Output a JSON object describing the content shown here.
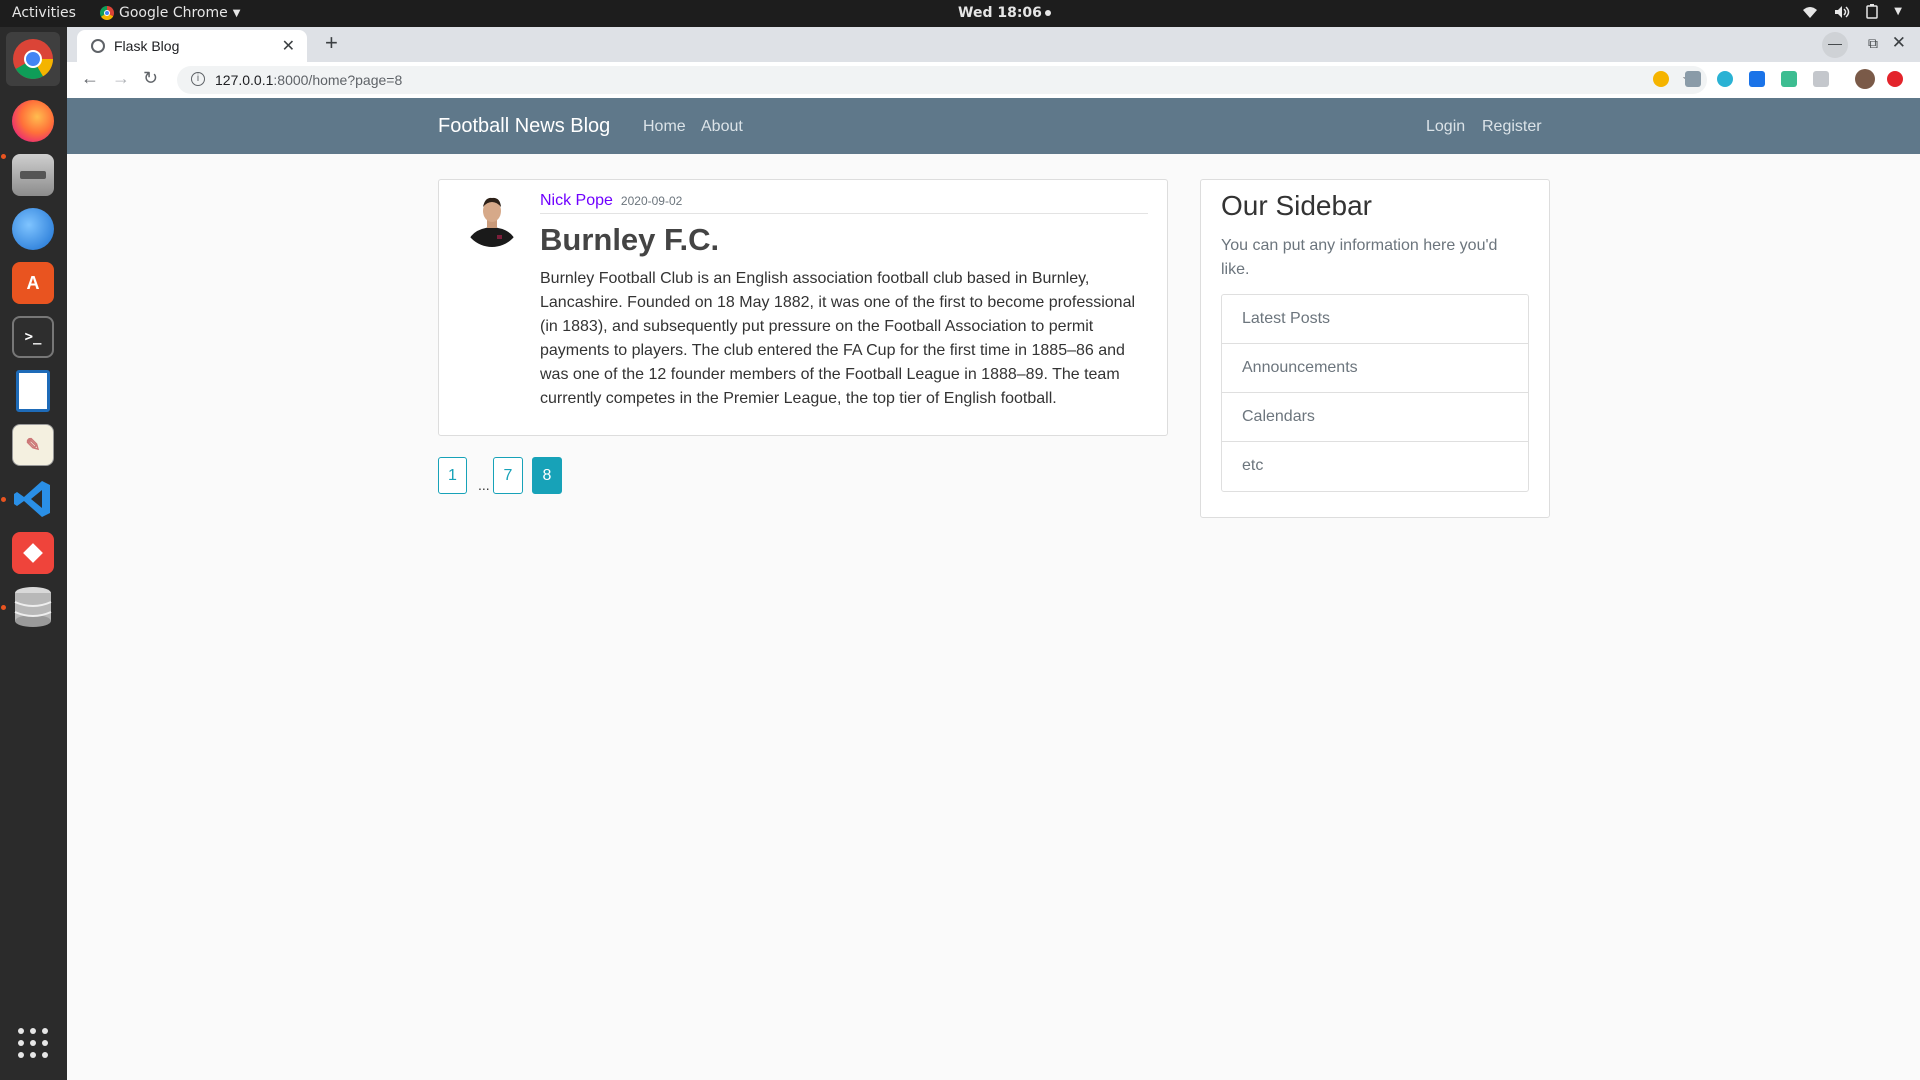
{
  "system": {
    "activities_label": "Activities",
    "app_name": "Google Chrome",
    "clock": "Wed 18:06"
  },
  "browser": {
    "tab_title": "Flask Blog",
    "url_host": "127.0.0.1",
    "url_path": ":8000/home?page=8"
  },
  "site": {
    "brand": "Football News Blog",
    "nav_left": [
      "Home",
      "About"
    ],
    "nav_right": [
      "Login",
      "Register"
    ],
    "colors": {
      "navbar": "#5f788a",
      "accent": "#17a2b8",
      "author_link": "#6f00ff"
    }
  },
  "post": {
    "author": "Nick Pope",
    "date": "2020-09-02",
    "title": "Burnley F.C.",
    "content": "Burnley Football Club is an English association football club based in Burnley, Lancashire. Founded on 18 May 1882, it was one of the first to become professional (in 1883), and subsequently put pressure on the Football Association to permit payments to players. The club entered the FA Cup for the first time in 1885–86 and was one of the 12 founder members of the Football League in 1888–89. The team currently competes in the Premier League, the top tier of English football."
  },
  "pagination": {
    "pages": [
      "1",
      "7",
      "8"
    ],
    "ellipsis": "...",
    "current": "8"
  },
  "sidebar": {
    "title": "Our Sidebar",
    "description": "You can put any information here you'd like.",
    "items": [
      "Latest Posts",
      "Announcements",
      "Calendars",
      "etc"
    ]
  }
}
